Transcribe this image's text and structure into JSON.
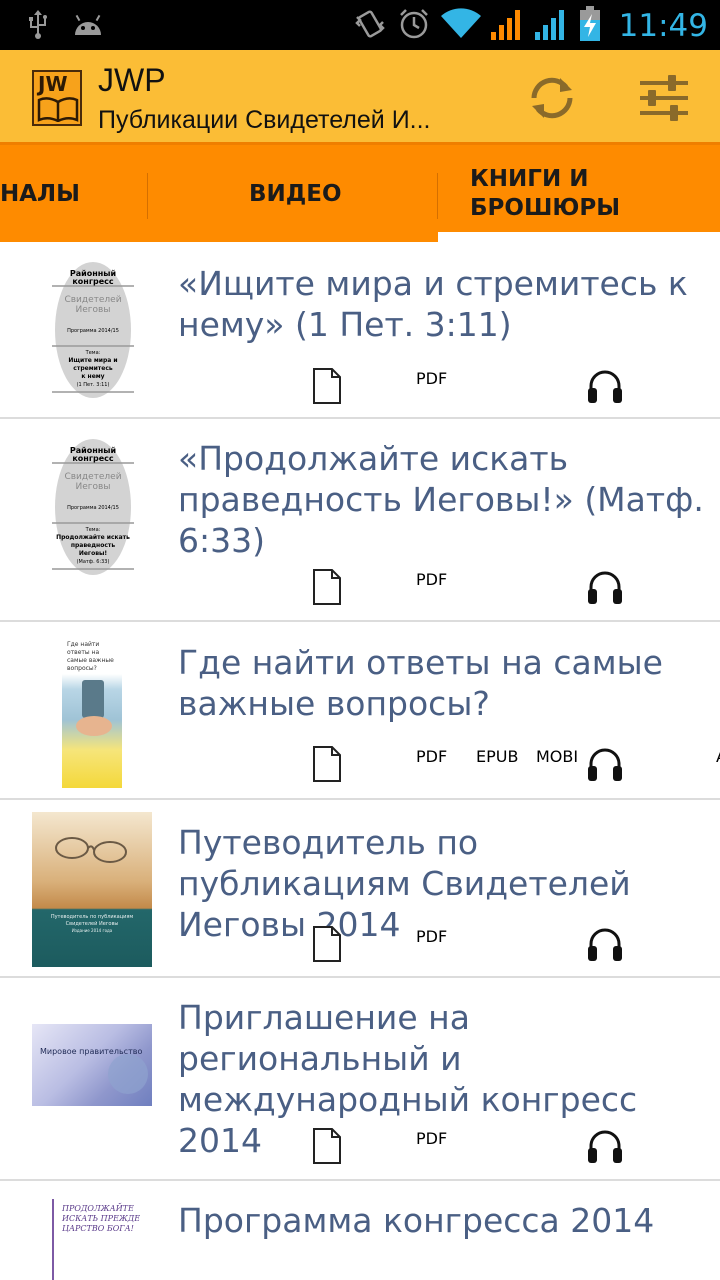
{
  "status_bar": {
    "time": "11:49",
    "left_icons": [
      "usb-icon",
      "android-icon"
    ],
    "right_icons": [
      "vibrate-icon",
      "alarm-icon",
      "wifi-icon",
      "signal-icon",
      "signal-icon",
      "battery-charging-icon"
    ]
  },
  "action_bar": {
    "logo_text": "JW",
    "title": "JWP",
    "subtitle": "Публикации Свидетелей И...",
    "actions": [
      "refresh-icon",
      "settings-sliders-icon"
    ]
  },
  "tabs": [
    {
      "label": "НАЛЫ",
      "active": false
    },
    {
      "label": "ВИДЕО",
      "active": false
    },
    {
      "label": "КНИГИ И БРОШЮРЫ",
      "active": true
    }
  ],
  "colors": {
    "accent_orange": "#fe8b00",
    "action_bar": "#fbbd36",
    "title_text": "#4a5f84",
    "status_blue": "#33b5e5"
  },
  "items": [
    {
      "title": "«Ищите мира и стремитесь к нему» (1 Пет. 3:11)",
      "thumb": {
        "lines": [
          "Районный",
          "конгресс",
          "Свидетелей",
          "Иеговы",
          "Программа 2014/15",
          "Тема:",
          "Ищите мира и",
          "стремитесь",
          "к нему",
          "(1 Пет. 3:11)"
        ]
      },
      "formats": [
        "document-icon",
        "PDF",
        "",
        "",
        "headphones-icon",
        "",
        ""
      ]
    },
    {
      "title": "«Продолжайте искать праведность Иеговы!» (Матф. 6:33)",
      "thumb": {
        "lines": [
          "Районный",
          "конгресс",
          "Свидетелей",
          "Иеговы",
          "Программа 2014/15",
          "Тема:",
          "Продолжайте искать",
          "праведность",
          "Иеговы!",
          "(Матф. 6:33)"
        ]
      },
      "formats": [
        "document-icon",
        "PDF",
        "",
        "",
        "headphones-icon",
        "",
        ""
      ]
    },
    {
      "title": "Где найти ответы на самые важные вопросы?",
      "thumb": {
        "lines": [
          "Где найти",
          "ответы на",
          "самые важные",
          "вопросы?"
        ]
      },
      "formats": [
        "document-icon",
        "PDF",
        "EPUB",
        "MOBI",
        "headphones-icon",
        "",
        "AAC"
      ]
    },
    {
      "title": "Путеводитель по публикациям Свидетелей Иеговы 2014",
      "thumb": {
        "lines": [
          "Путеводитель по публикациям",
          "Свидетелей Иеговы",
          "Издание 2014 года"
        ]
      },
      "formats": [
        "document-icon",
        "PDF",
        "",
        "",
        "headphones-icon",
        "",
        ""
      ]
    },
    {
      "title": "Приглашение на региональный и международный конгресс 2014",
      "thumb": {
        "lines": [
          "Мировое правительство"
        ]
      },
      "formats": [
        "document-icon",
        "PDF",
        "",
        "",
        "headphones-icon",
        "",
        ""
      ]
    },
    {
      "title": "Программа конгресса 2014",
      "thumb": {
        "lines": [
          "ПРОДОЛЖАЙТЕ",
          "ИСКАТЬ ПРЕЖДЕ",
          "ЦАРСТВО БОГА!"
        ]
      },
      "formats": []
    }
  ]
}
